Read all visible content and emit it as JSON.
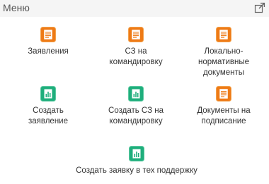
{
  "panel": {
    "title": "Меню"
  },
  "colors": {
    "orange_icon": "#ee7a16",
    "orange_icon_border": "#f3a24d",
    "green_icon": "#1fae7c",
    "green_icon_border": "#5cc9a1",
    "text": "#333333",
    "header_bg": "#f5f5f5"
  },
  "menu": {
    "items": [
      {
        "label": "Заявления",
        "icon": "document-list-icon",
        "color": "orange"
      },
      {
        "label": "СЗ на командировку",
        "icon": "document-list-icon",
        "color": "orange"
      },
      {
        "label": "Локально-нормативные документы",
        "icon": "document-list-icon",
        "color": "orange"
      },
      {
        "label": "Создать заявление",
        "icon": "bar-chart-icon",
        "color": "green"
      },
      {
        "label": "Создать СЗ на командировку",
        "icon": "bar-chart-icon",
        "color": "green"
      },
      {
        "label": "Документы на подписание",
        "icon": "document-list-icon",
        "color": "orange"
      },
      {
        "label": "Создать заявку в тех поддержку",
        "icon": "bar-chart-icon",
        "color": "green"
      }
    ]
  }
}
